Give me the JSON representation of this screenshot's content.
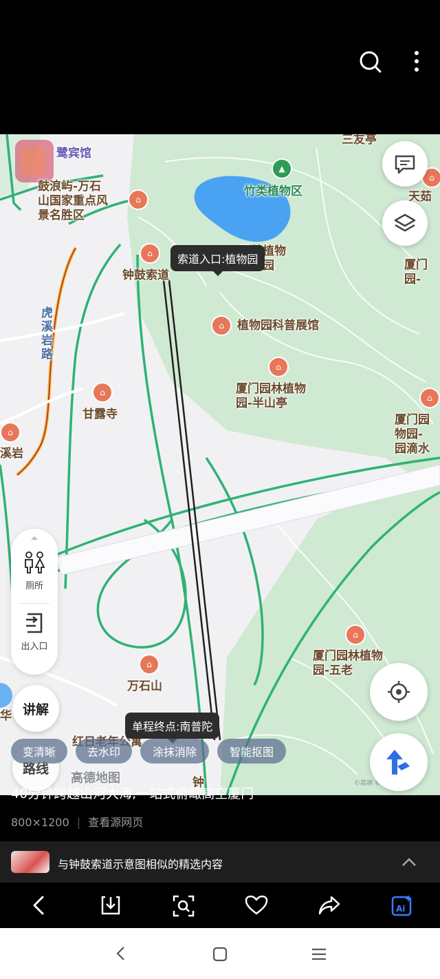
{
  "map": {
    "tooltip_top": "索道入口:植物园",
    "tooltip_bottom": "单程终点:南普陀",
    "labels": {
      "heron_hotel": "鹭宾馆",
      "gulangyu": "鼓浪屿-万石\n山国家重点风\n景名胜区",
      "bamboo": "竹类植物区",
      "garden_rose": "园林植物\n蔷薇园",
      "zhonggu": "钟鼓索道",
      "science": "植物园科普展馆",
      "banshan": "厦门园林植物\n园-半山亭",
      "ganlu": "甘露寺",
      "huxi_road": "虎\n溪\n岩\n路",
      "xiyan": "溪岩",
      "sanyou": "三友亭",
      "tianzhu": "天茹",
      "xiamen_right": "厦门\n园-",
      "dishui": "厦门园\n物园-\n园滴水",
      "wulao": "厦门园林植物\n园-五老",
      "wanshishan": "万石山",
      "hongri": "红日老年公寓",
      "zhong_bottom": "钟",
      "hua": "华",
      "amap": "高德地图",
      "copyright": "©高德 ©Amap"
    },
    "side_panel": {
      "toilet_label": "厕所",
      "exit_label": "出入口"
    },
    "explain_label": "讲解",
    "route_label": "路线"
  },
  "chips": [
    "变清晰",
    "去水印",
    "涂抹消除",
    "智能抠图"
  ],
  "caption": "40分钟跨越山河大海,一站式俯瞰高空厦门",
  "meta": {
    "size": "800×1200",
    "source": "查看源网页"
  },
  "similar": {
    "text": "与钟鼓索道示意图相似的精选内容"
  },
  "colors": {
    "park_green": "#cfe9d2",
    "road_green": "#2fb274",
    "accent_blue": "#2f6fe4",
    "pin_orange": "#e8775a"
  }
}
